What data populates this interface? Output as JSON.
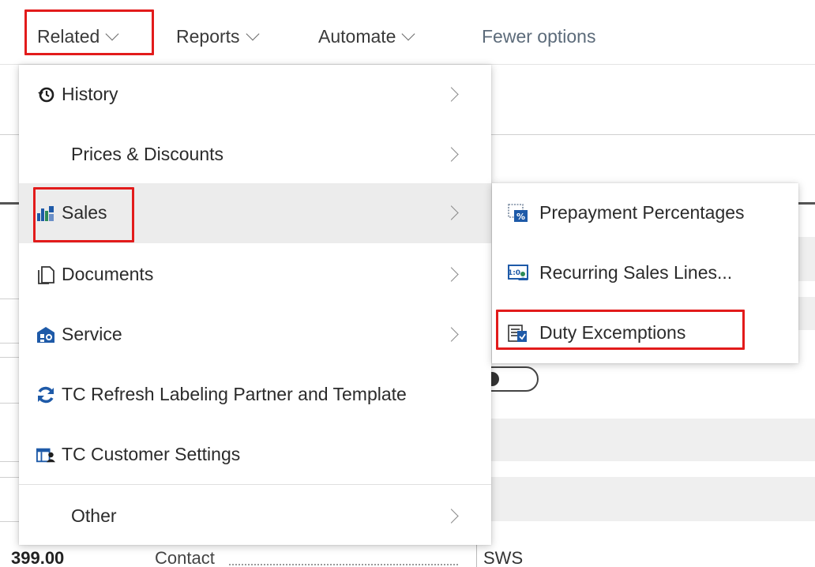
{
  "action_bar": {
    "items": [
      {
        "label": "Related"
      },
      {
        "label": "Reports"
      },
      {
        "label": "Automate"
      },
      {
        "label": "Fewer options"
      }
    ]
  },
  "related_menu": {
    "items": [
      {
        "label": "History",
        "icon": "history-icon",
        "has_submenu": true
      },
      {
        "label": "Prices & Discounts",
        "icon": "",
        "has_submenu": true
      },
      {
        "label": "Sales",
        "icon": "sales-icon",
        "has_submenu": true,
        "active": true
      },
      {
        "label": "Documents",
        "icon": "document-icon",
        "has_submenu": true
      },
      {
        "label": "Service",
        "icon": "service-icon",
        "has_submenu": true
      },
      {
        "label": "TC Refresh Labeling Partner and Template",
        "icon": "refresh-icon",
        "has_submenu": false
      },
      {
        "label": "TC Customer Settings",
        "icon": "customer-settings-icon",
        "has_submenu": false
      },
      {
        "label": "Other",
        "icon": "",
        "has_submenu": true
      }
    ]
  },
  "sales_submenu": {
    "items": [
      {
        "label": "Prepayment Percentages",
        "icon": "prepayment-icon"
      },
      {
        "label": "Recurring Sales Lines...",
        "icon": "recurring-lines-icon"
      },
      {
        "label": "Duty Excemptions",
        "icon": "duty-exemptions-icon"
      }
    ]
  },
  "background": {
    "amount": "399.00",
    "contact_label": "Contact",
    "contact_value": "SWS"
  },
  "colors": {
    "highlight": "#e21b1b",
    "active_row": "#ececec",
    "icon_blue": "#1e5aa8",
    "icon_green": "#2e8b57"
  }
}
